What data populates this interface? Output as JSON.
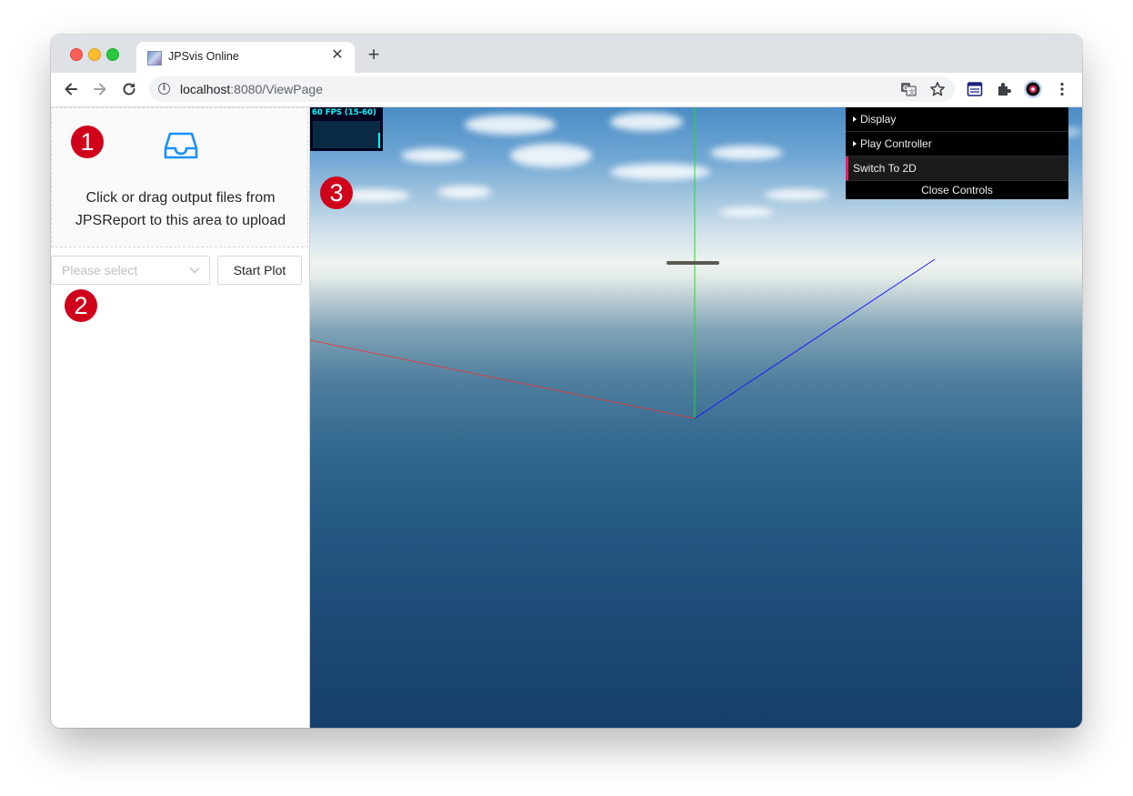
{
  "browser": {
    "tab_title": "JPSvis Online",
    "tab_close": "✕",
    "new_tab": "+",
    "url_host": "localhost",
    "url_path": ":8080/ViewPage"
  },
  "sidebar": {
    "upload_text_line1": "Click or drag output files from",
    "upload_text_line2": "JPSReport to this area to upload",
    "select_placeholder": "Please select",
    "start_button": "Start Plot"
  },
  "badges": [
    "1",
    "2",
    "3"
  ],
  "viewport": {
    "fps_label": "60 FPS (15-60)",
    "fps_level": 0.55
  },
  "controls": {
    "display": "Display",
    "play_controller": "Play Controller",
    "switch_2d": "Switch To 2D",
    "close": "Close Controls"
  },
  "colors": {
    "badge": "#d0021b",
    "axis_x": "#ff2a2a",
    "axis_y": "#22dd22",
    "axis_z": "#1a1aff",
    "upload_icon": "#1890ff",
    "gui_accent": "#e61d5f"
  },
  "icons": [
    "back-arrow-icon",
    "forward-arrow-icon",
    "reload-icon",
    "info-icon",
    "translate-icon",
    "star-icon",
    "reader-icon",
    "extensions-icon",
    "profile-icon",
    "menu-dots-icon",
    "inbox-icon",
    "chevron-down-icon"
  ]
}
